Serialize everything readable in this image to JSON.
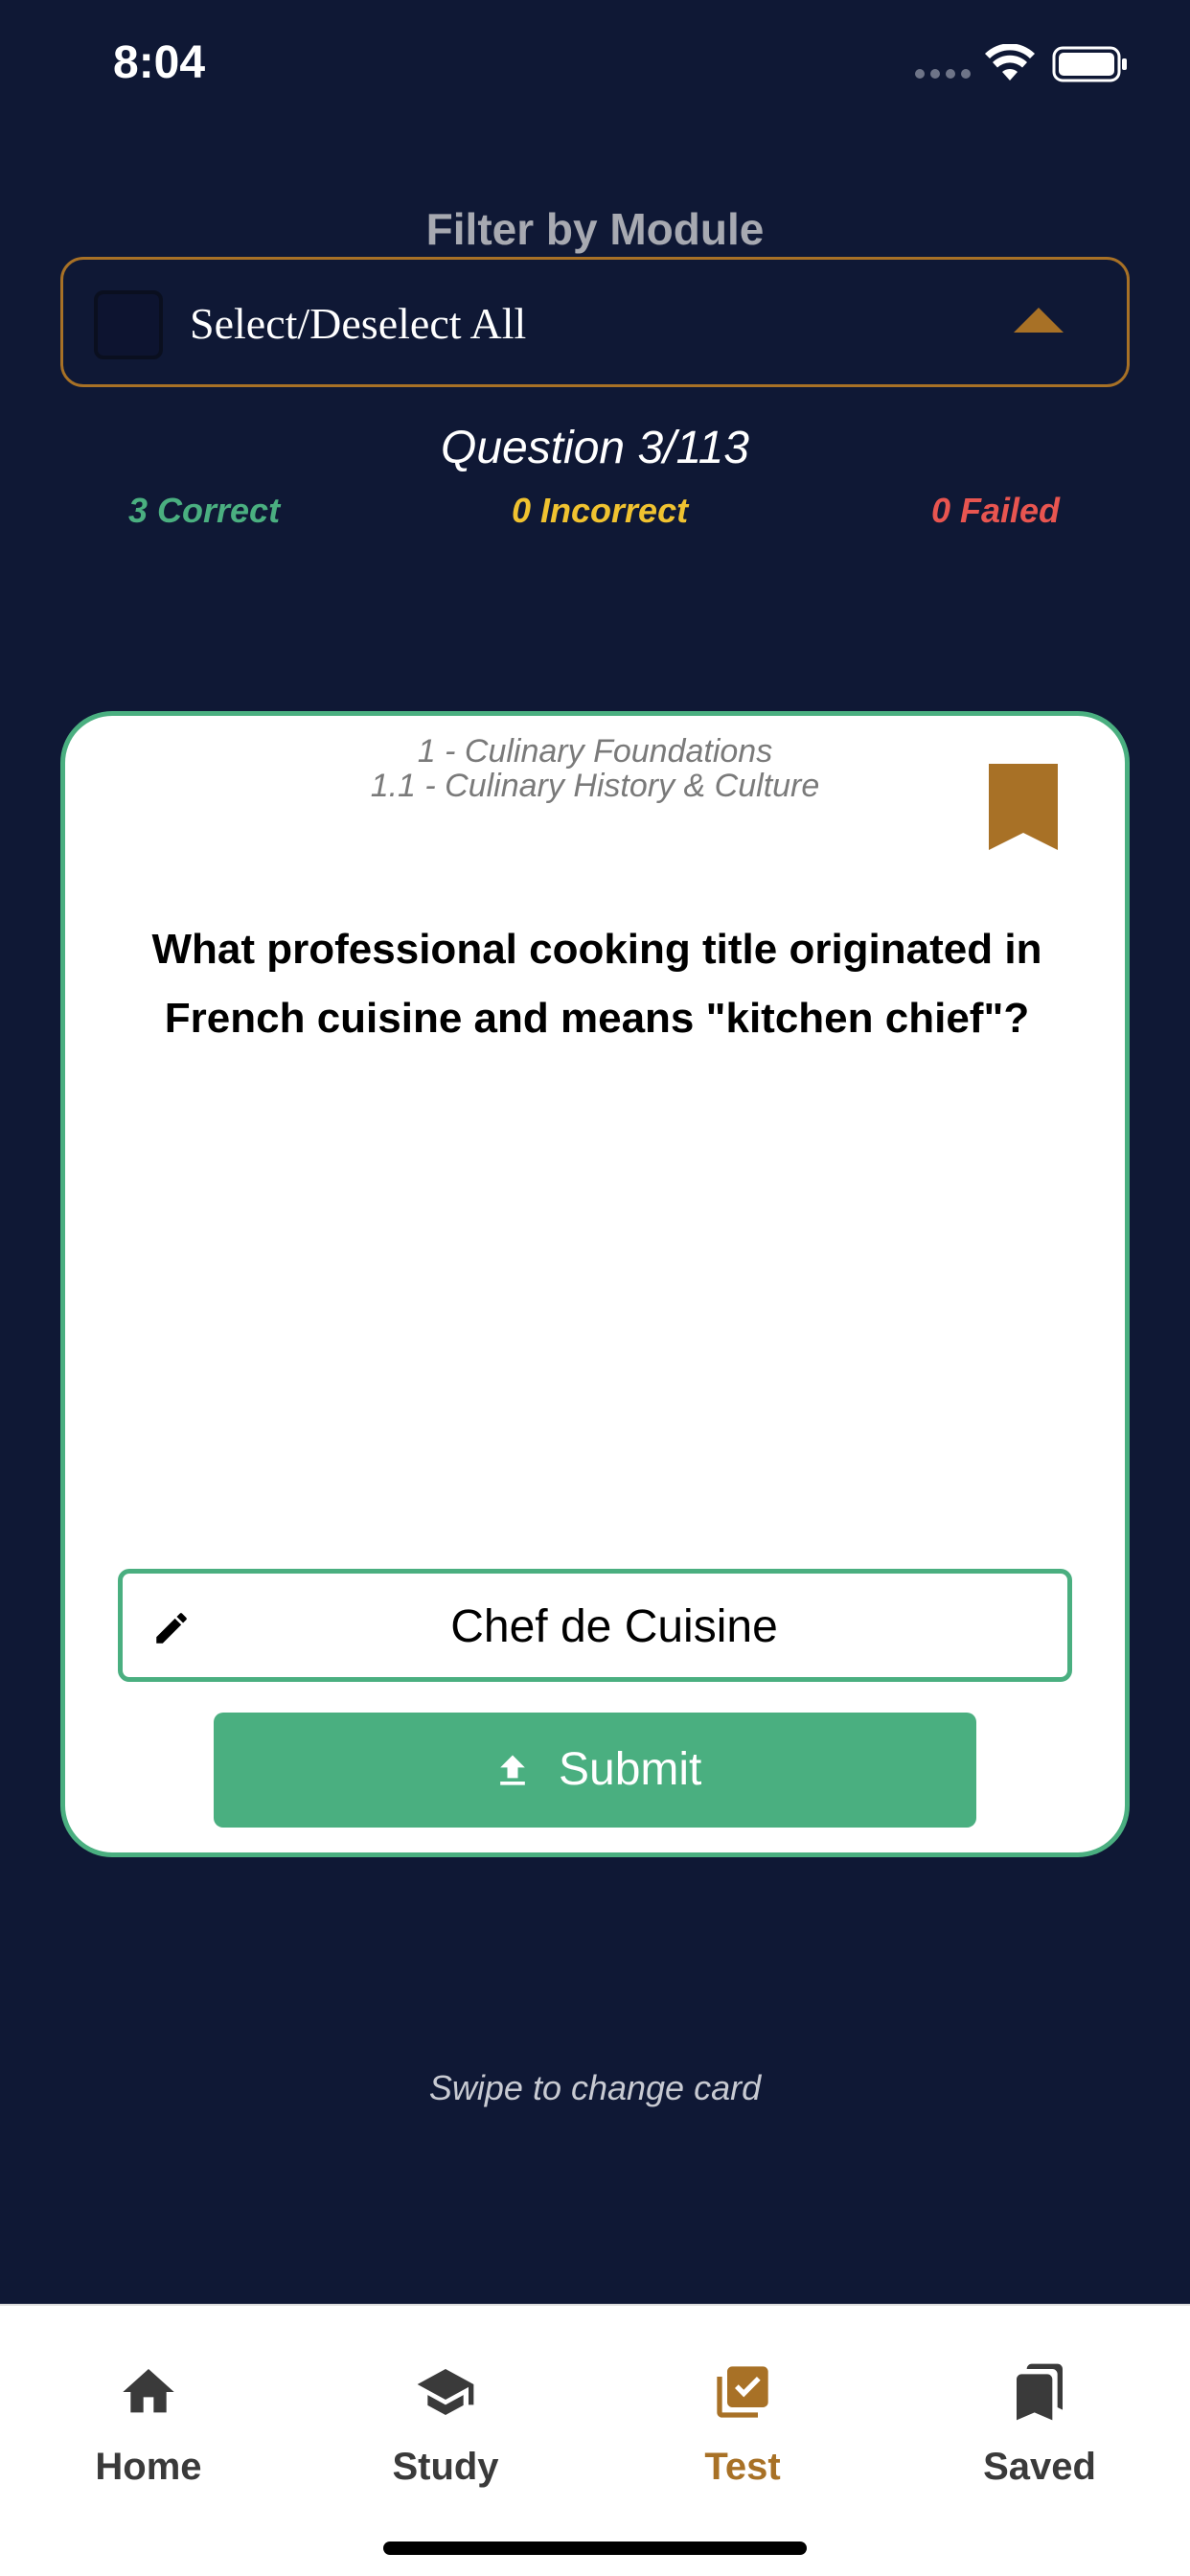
{
  "status": {
    "time": "8:04"
  },
  "filter": {
    "label": "Filter by Module",
    "select_all": "Select/Deselect All"
  },
  "progress": {
    "counter": "Question 3/113",
    "correct": "3 Correct",
    "incorrect": "0 Incorrect",
    "failed": "0 Failed"
  },
  "card": {
    "module": "1 - Culinary Foundations",
    "submodule": "1.1 - Culinary History & Culture",
    "question": "What professional cooking title originated in French cuisine and means \"kitchen chief\"?",
    "answer": "Chef de Cuisine",
    "submit": "Submit"
  },
  "hint": "Swipe to change card",
  "tabs": [
    {
      "label": "Home",
      "icon": "home-icon"
    },
    {
      "label": "Study",
      "icon": "graduation-cap-icon"
    },
    {
      "label": "Test",
      "icon": "checked-box-icon",
      "active": true
    },
    {
      "label": "Saved",
      "icon": "bookmarks-icon"
    }
  ],
  "colors": {
    "background": "#0f1835",
    "accent": "#a87126",
    "correct": "#4aaf80",
    "incorrect": "#f0c230",
    "failed": "#e85550"
  }
}
